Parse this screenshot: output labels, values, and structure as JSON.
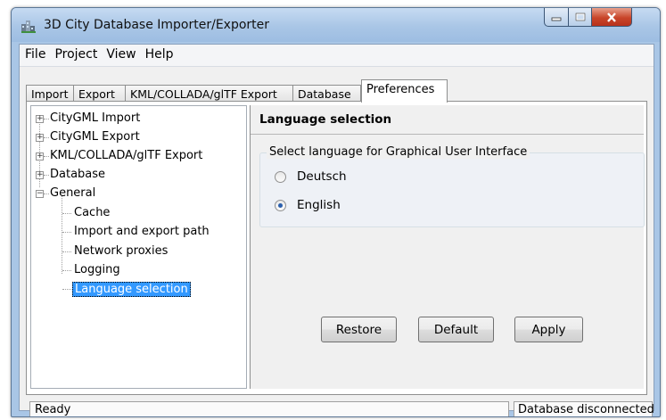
{
  "window": {
    "title": "3D City Database Importer/Exporter"
  },
  "menu": [
    "File",
    "Project",
    "View",
    "Help"
  ],
  "tabs": [
    "Import",
    "Export",
    "KML/COLLADA/glTF Export",
    "Database",
    "Preferences"
  ],
  "active_tab": "Preferences",
  "tree": {
    "top": [
      "CityGML Import",
      "CityGML Export",
      "KML/COLLADA/glTF Export",
      "Database",
      "General"
    ],
    "children": [
      "Cache",
      "Import and export path",
      "Network proxies",
      "Logging",
      "Language selection"
    ],
    "selected": "Language selection"
  },
  "section": {
    "title": "Language selection",
    "group_label": "Select language for Graphical User Interface",
    "options": [
      {
        "label": "Deutsch",
        "checked": false
      },
      {
        "label": "English",
        "checked": true
      }
    ]
  },
  "buttons": {
    "restore": "Restore",
    "default": "Default",
    "apply": "Apply"
  },
  "status": {
    "left": "Ready",
    "right": "Database disconnected"
  }
}
